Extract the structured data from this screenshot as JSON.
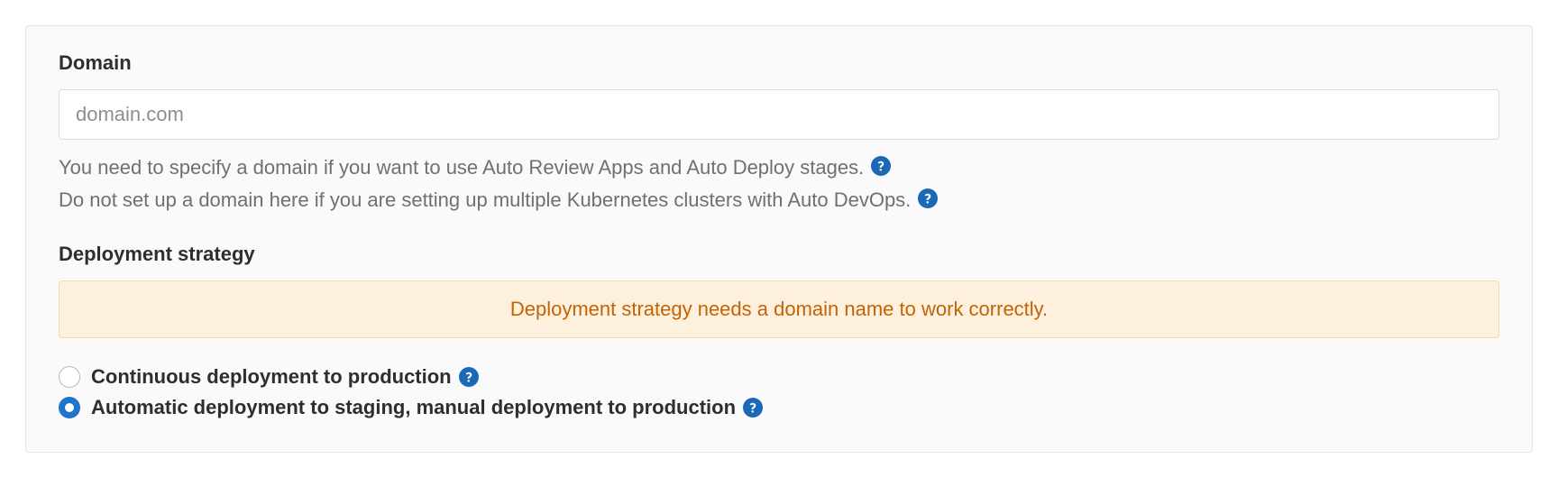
{
  "domain_section": {
    "label": "Domain",
    "placeholder": "domain.com",
    "value": "",
    "help_line_1": "You need to specify a domain if you want to use Auto Review Apps and Auto Deploy stages.",
    "help_line_2": "Do not set up a domain here if you are setting up multiple Kubernetes clusters with Auto DevOps."
  },
  "strategy_section": {
    "label": "Deployment strategy",
    "warning": "Deployment strategy needs a domain name to work correctly.",
    "options": [
      {
        "label": "Continuous deployment to production",
        "selected": false
      },
      {
        "label": "Automatic deployment to staging, manual deployment to production",
        "selected": true
      }
    ]
  },
  "icons": {
    "help": "help-circle-icon"
  },
  "colors": {
    "help_icon": "#1b69b6",
    "warning_bg": "#fdf1dd",
    "warning_border": "#f5d9a8",
    "warning_text": "#c46306",
    "radio_checked": "#1f75cb"
  }
}
